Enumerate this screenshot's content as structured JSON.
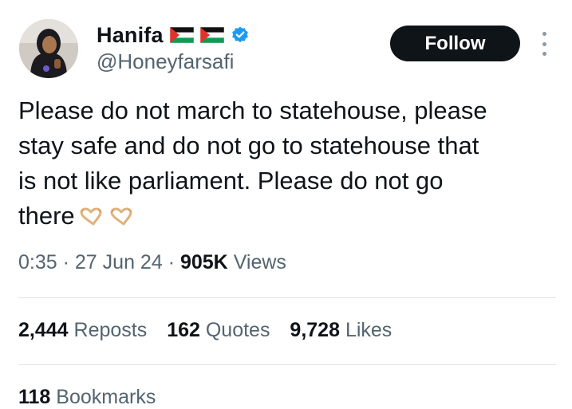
{
  "author": {
    "display_name": "Hanifa",
    "handle": "@Honeyfarsafi",
    "flag_icons": [
      "palestine-flag-icon",
      "palestine-flag-icon"
    ],
    "verified_icon": "verified-badge-icon",
    "verified_color": "#1d9bf0"
  },
  "actions": {
    "follow_label": "Follow",
    "more_icon": "more-vertical-icon"
  },
  "tweet": {
    "text_lines": [
      "Please do not march to statehouse, please",
      "stay safe and do not go to statehouse that",
      "is not like parliament. Please do not go",
      "there"
    ],
    "emoji": "heart-hands-emoji"
  },
  "meta": {
    "time": "0:35",
    "separator": "·",
    "date": "27 Jun 24",
    "views_count": "905K",
    "views_label": "Views"
  },
  "stats": {
    "reposts_count": "2,444",
    "reposts_label": "Reposts",
    "quotes_count": "162",
    "quotes_label": "Quotes",
    "likes_count": "9,728",
    "likes_label": "Likes",
    "bookmarks_count": "118",
    "bookmarks_label": "Bookmarks"
  },
  "colors": {
    "text_primary": "#0f1419",
    "text_secondary": "#536471",
    "button_bg": "#0f1419",
    "divider": "#dfe3e6"
  }
}
